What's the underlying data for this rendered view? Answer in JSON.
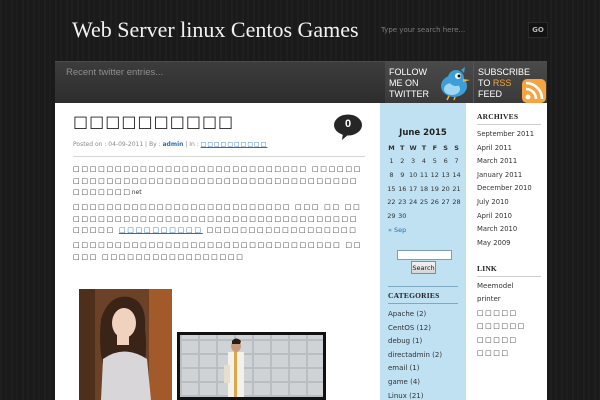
{
  "header": {
    "site_title": "Web Server linux Centos Games",
    "search_placeholder": "Type your search here...",
    "search_button": "GO"
  },
  "twitter_bar": {
    "recent_text": "Recent twitter entries...",
    "follow_line1": "FOLLOW",
    "follow_line2": "ME ON",
    "follow_line3": "TWITTER",
    "subscribe_line1": "SUBSCRIBE",
    "subscribe_to": "TO",
    "subscribe_rss": "RSS",
    "subscribe_line3": "FEED"
  },
  "post": {
    "title": "□□□□□□□□□□",
    "comment_count": "0",
    "meta_prefix": "Posted on : 04-09-2011 | By : ",
    "meta_author": "admin",
    "meta_in": " | In : ",
    "meta_category": "□□□□□□□□□□",
    "para1": "□□□□□□□□□□□□□□□□□□□□□□□□□□□□ □□□□□□□□□□□□□□□□□□□□□□□□□□□□□□□□□□□□□□□□□□□□□□□",
    "para1_tail": "net",
    "para2a": "□□□□□□□□□□□□□□□□□□□□□□□□□□ □□□ □□ □□□□□□□□□□□□□□□□□□□□□□□□□□□□□□□□□□□□□□□□□ ",
    "para2_link": "□□□□□□□□□□",
    "para2b": " □□□□□□□□□□□□□□□□□□",
    "para3": "□□□□□□□□□□□□□□□□□□□□□□□□□□□□□□□□ □□□□□ □□□□□□□□□□□□□□□□□"
  },
  "calendar": {
    "title": "June 2015",
    "days": [
      "M",
      "T",
      "W",
      "T",
      "F",
      "S",
      "S"
    ],
    "weeks": [
      [
        "1",
        "2",
        "3",
        "4",
        "5",
        "6",
        "7"
      ],
      [
        "8",
        "9",
        "10",
        "11",
        "12",
        "13",
        "14"
      ],
      [
        "15",
        "16",
        "17",
        "18",
        "19",
        "20",
        "21"
      ],
      [
        "22",
        "23",
        "24",
        "25",
        "26",
        "27",
        "28"
      ],
      [
        "29",
        "30",
        "",
        "",
        "",
        "",
        ""
      ]
    ],
    "prev_link": "« Sep"
  },
  "sidebar_search": {
    "button": "Search"
  },
  "categories": {
    "heading": "CATEGORIES",
    "items": [
      "Apache (2)",
      "CentOS (12)",
      "debug (1)",
      "directadmin (2)",
      "email (1)",
      "game (4)",
      "Linux (21)"
    ]
  },
  "archives": {
    "heading": "ARCHIVES",
    "items": [
      "September 2011",
      "April 2011",
      "March 2011",
      "January 2011",
      "December 2010",
      "July 2010",
      "April 2010",
      "March 2010",
      "May 2009"
    ]
  },
  "links": {
    "heading": "LINK",
    "items": [
      "Meemodel",
      "printer",
      "□□□□□",
      "□□□□□□",
      "□□□□□",
      "□□□□"
    ]
  },
  "colors": {
    "background": "#1b1b1b",
    "sidebar_blue": "#bfe1f2",
    "link": "#2a6fb4",
    "rss_orange": "#f7a440",
    "twitter_bird": "#3d9fd8"
  }
}
